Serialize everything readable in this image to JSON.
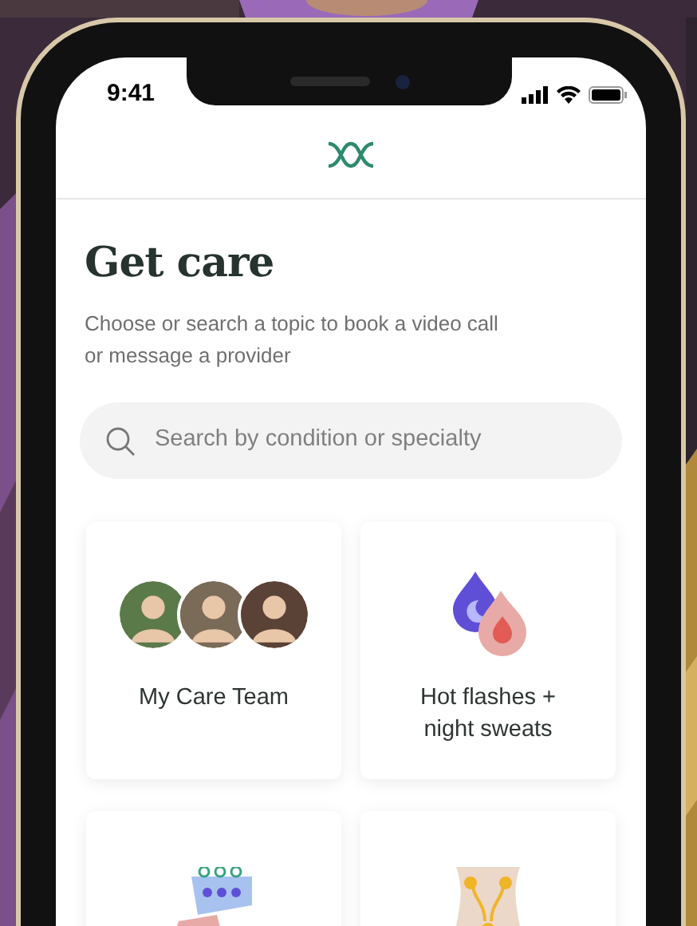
{
  "status_bar": {
    "time": "9:41"
  },
  "title": "Get care",
  "subtitle": "Choose or search a topic to book a video call or message a provider",
  "search": {
    "placeholder": "Search by condition or specialty"
  },
  "cards": [
    {
      "kind": "team",
      "label": "My Care Team"
    },
    {
      "kind": "droplets",
      "label": "Hot flashes + night sweats"
    },
    {
      "kind": "calendar"
    },
    {
      "kind": "body"
    }
  ]
}
